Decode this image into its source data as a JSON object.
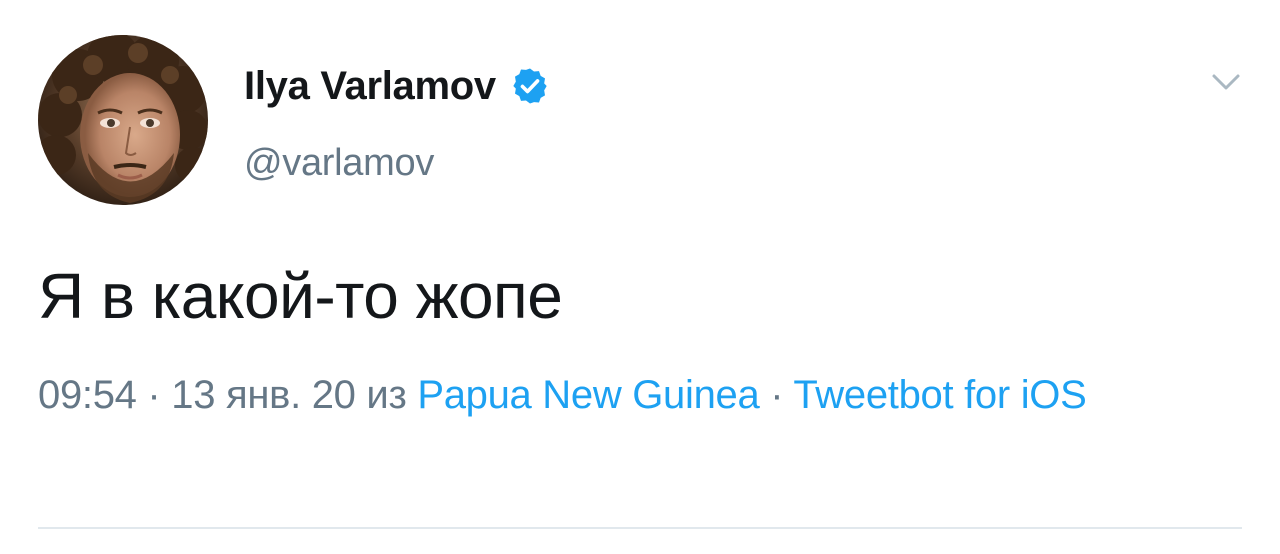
{
  "user": {
    "display_name": "Ilya Varlamov",
    "handle": "@varlamov",
    "verified": true
  },
  "tweet": {
    "text": "Я в какой-то жопе"
  },
  "meta": {
    "time": "09:54",
    "sep1": " · ",
    "date": "13 янв. 20",
    "from_word": " из ",
    "location": "Papua New Guinea",
    "sep2": " · ",
    "client": "Tweetbot for iOS"
  },
  "icons": {
    "verified": "verified-badge-icon",
    "caret": "chevron-down-icon"
  },
  "colors": {
    "link": "#1da1f2",
    "secondary_text": "#657786",
    "primary_text": "#14171a",
    "divider": "#e1e8ed"
  }
}
